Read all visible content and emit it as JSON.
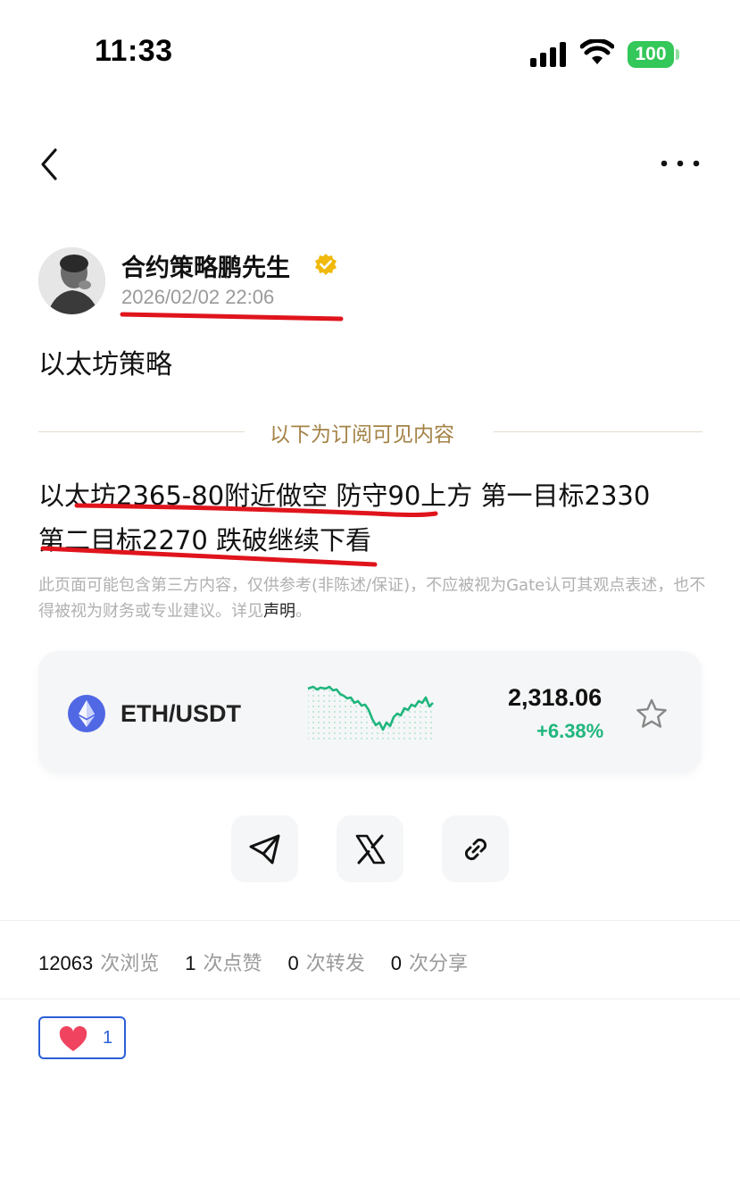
{
  "status_bar": {
    "time": "11:33",
    "battery": "100"
  },
  "author": {
    "name": "合约策略鹏先生",
    "date": "2026/02/02 22:06"
  },
  "post": {
    "title": "以太坊策略",
    "subscriber_label": "以下为订阅可见内容",
    "body_line_1": "以太坊2365-80附近做空 防守90上方 第一目标2330",
    "body_line_2": "第二目标2270 跌破继续下看",
    "disclaimer_text": "此页面可能包含第三方内容，仅供参考(非陈述/保证)，不应被视为Gate认可其观点表述，也不得被视为财务或专业建议。详见",
    "disclaimer_link": "声明",
    "disclaimer_end": "。"
  },
  "ticker": {
    "pair": "ETH/USDT",
    "price": "2,318.06",
    "change": "+6.38%",
    "change_color": "#1fb67d",
    "icon": "ethereum-icon"
  },
  "share": {
    "buttons": [
      "telegram-icon",
      "x-icon",
      "link-icon"
    ]
  },
  "stats": {
    "views": "12063",
    "views_label": "次浏览",
    "likes": "1",
    "likes_label": "次点赞",
    "reposts": "0",
    "reposts_label": "次转发",
    "shares": "0",
    "shares_label": "次分享"
  },
  "reaction": {
    "icon": "heart-icon",
    "count": "1",
    "accent": "#2b5fd9"
  },
  "colors": {
    "accent_gold": "#a48347",
    "verified": "#f0b90b",
    "positive": "#1fb67d",
    "annotation_red": "#e0141c"
  }
}
